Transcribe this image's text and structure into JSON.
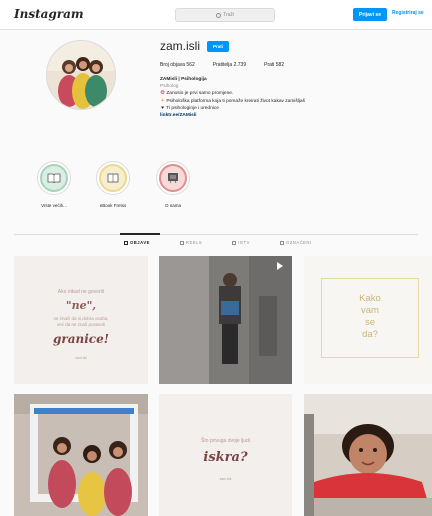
{
  "header": {
    "logo": "Instagram",
    "search_placeholder": "Traži",
    "login_label": "Prijavi se",
    "signup_label": "Registriraj se"
  },
  "profile": {
    "username": "zam.isli",
    "follow_label": "Prati",
    "stats": {
      "posts": "Broj objava 562",
      "followers": "Pratitelja 2.739",
      "following": "Prati 582"
    },
    "bio": {
      "name": "ZAMisli | Psihologija",
      "category": "Psiholog",
      "line1": "Zanosio je prvi samo promjene.",
      "line2": "Psihološka platforma koja ti pomaže kreirati život kakav zamišljaš",
      "line3": "Ti psihologinje i urednice",
      "link": "linktr.ee/ZAMisli"
    }
  },
  "highlights": [
    {
      "label": "Vrste većih..."
    },
    {
      "label": "eBook Fretss"
    },
    {
      "label": "O nama"
    }
  ],
  "tabs": [
    {
      "label": "OBJAVE"
    },
    {
      "label": "REELS"
    },
    {
      "label": "IGTV"
    },
    {
      "label": "OZNAČENI"
    }
  ],
  "posts": {
    "p1": {
      "line_a": "Ako nikad ne govoriš",
      "word": "\"ne\",",
      "line_c1": "ne znači da si dobra osoba,",
      "line_c2": "već da ne znaš postaviti",
      "word2": "granice!",
      "handle": "zam.isli"
    },
    "p3": {
      "line1": "Kako",
      "line2": "vam",
      "line3": "se",
      "line4": "da?"
    },
    "p5": {
      "line_a": "Što privuga dvoje ljudi",
      "word": "iskra?",
      "handle": "zam.isli"
    }
  }
}
